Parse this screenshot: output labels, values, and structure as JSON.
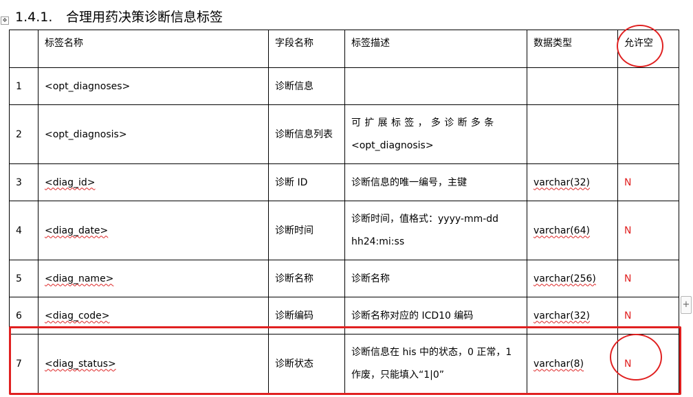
{
  "heading": {
    "number": "1.4.1.",
    "title": "合理用药决策诊断信息标签"
  },
  "table": {
    "headers": [
      "标签名称",
      "字段名称",
      "标签描述",
      "数据类型",
      "允许空"
    ],
    "rows": [
      {
        "no": "1",
        "tag": "<opt_diagnoses>",
        "field": "诊断信息",
        "desc": "",
        "type": "",
        "nullable": ""
      },
      {
        "no": "2",
        "tag": "<opt_diagnosis>",
        "field": "诊断信息列表",
        "desc_line1": "可扩展标签，多诊断多条",
        "desc_line2": "<opt_diagnosis>",
        "type": "",
        "nullable": ""
      },
      {
        "no": "3",
        "tag": "<diag_id>",
        "field": "诊断 ID",
        "desc": "诊断信息的唯一编号，主键",
        "type": "varchar(32)",
        "nullable": "N"
      },
      {
        "no": "4",
        "tag": "<diag_date>",
        "field": "诊断时间",
        "desc_line1": "诊断时间，值格式：yyyy-mm-dd",
        "desc_line2": "hh24:mi:ss",
        "type": "varchar(64)",
        "nullable": "N"
      },
      {
        "no": "5",
        "tag": "<diag_name>",
        "field": "诊断名称",
        "desc": "诊断名称",
        "type": "varchar(256)",
        "nullable": "N"
      },
      {
        "no": "6",
        "tag": "<diag_code>",
        "field": "诊断编码",
        "desc": "诊断名称对应的 ICD10 编码",
        "type": "varchar(32)",
        "nullable": "N"
      },
      {
        "no": "7",
        "tag": "<diag_status>",
        "field": "诊断状态",
        "desc_line1": "诊断信息在 his 中的状态，0 正常，1",
        "desc_line2": "作废，只能填入“1|0”",
        "type": "varchar(8)",
        "nullable": "N"
      }
    ]
  },
  "controls": {
    "add_row_symbol": "+",
    "move_handle_symbol": "✥"
  },
  "colors": {
    "annotation": "#e02020",
    "not_null_value": "#e02020",
    "spellcheck": "#d22222"
  }
}
